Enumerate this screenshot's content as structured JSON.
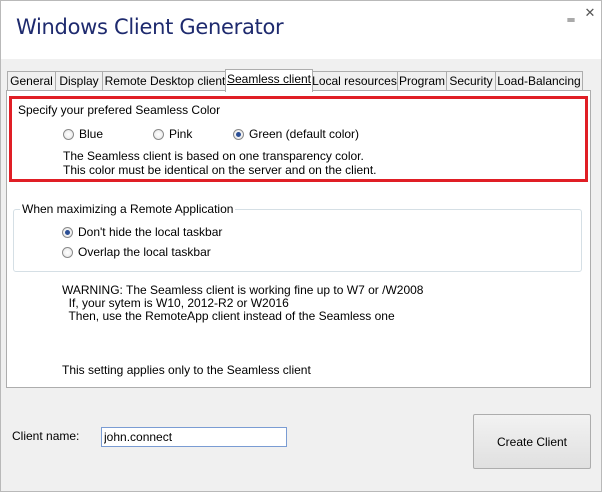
{
  "window": {
    "title": "Windows Client Generator",
    "minimize_glyph": "‗",
    "close_glyph": "✕"
  },
  "tabs": [
    {
      "label": "General",
      "selected": false
    },
    {
      "label": "Display",
      "selected": false
    },
    {
      "label": "Remote Desktop client",
      "selected": false
    },
    {
      "label": "Seamless client",
      "selected": true
    },
    {
      "label": "Local resources",
      "selected": false
    },
    {
      "label": "Program",
      "selected": false
    },
    {
      "label": "Security",
      "selected": false
    },
    {
      "label": "Load-Balancing",
      "selected": false
    }
  ],
  "seamless_color": {
    "legend": "Specify your prefered Seamless Color",
    "options": [
      {
        "label": "Blue",
        "checked": false
      },
      {
        "label": "Pink",
        "checked": false
      },
      {
        "label": "Green (default color)",
        "checked": true
      }
    ],
    "info_line1": "The Seamless client is based on one transparency color.",
    "info_line2": "This color must be identical on the server and on the client.",
    "highlight_color": "#e01e25"
  },
  "maximize": {
    "legend": "When maximizing a Remote Application",
    "options": [
      {
        "label": "Don't hide the local taskbar",
        "checked": true
      },
      {
        "label": "Overlap the local taskbar",
        "checked": false
      }
    ]
  },
  "warning": {
    "line1": "WARNING: The Seamless client is working fine up to W7 or /W2008",
    "line2": "  If, your sytem is W10, 2012-R2 or W2016",
    "line3": "  Then, use the RemoteApp client instead of the Seamless one"
  },
  "note": "This setting applies only to the Seamless client",
  "client_name": {
    "label": "Client name:",
    "value": "john.connect"
  },
  "create_button": "Create Client",
  "colors": {
    "title_text": "#1e2a6e",
    "radio_checked": "#2a4e95"
  }
}
